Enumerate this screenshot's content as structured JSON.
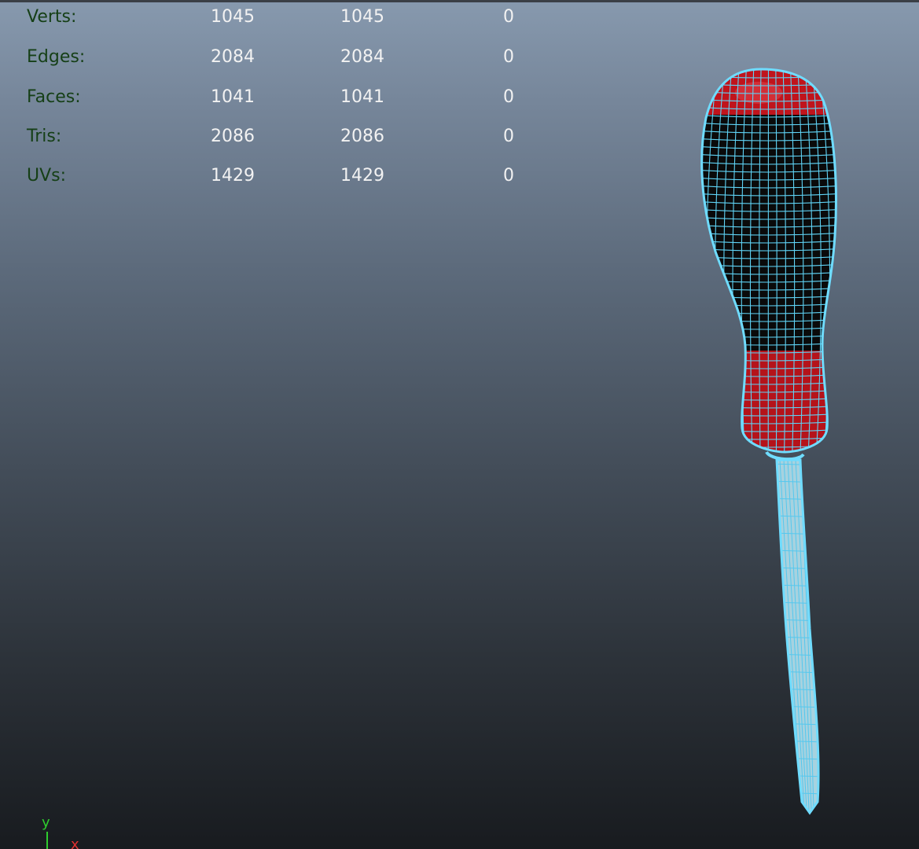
{
  "hud": {
    "rows": [
      {
        "label": "Verts:",
        "v1": "1045",
        "v2": "1045",
        "v3": "0"
      },
      {
        "label": "Edges:",
        "v1": "2084",
        "v2": "2084",
        "v3": "0"
      },
      {
        "label": "Faces:",
        "v1": "1041",
        "v2": "1041",
        "v3": "0"
      },
      {
        "label": "Tris:",
        "v1": "2086",
        "v2": "2086",
        "v3": "0"
      },
      {
        "label": "UVs:",
        "v1": "1429",
        "v2": "1429",
        "v3": "0"
      }
    ]
  },
  "axis": {
    "y_label": "y",
    "x_label": "x",
    "y_color": "#2ecc2e",
    "x_color": "#e03030"
  },
  "model": {
    "wire_color": "#5fd3f5",
    "handle_color": "#0a0a0a",
    "accent_color": "#c0141c"
  }
}
